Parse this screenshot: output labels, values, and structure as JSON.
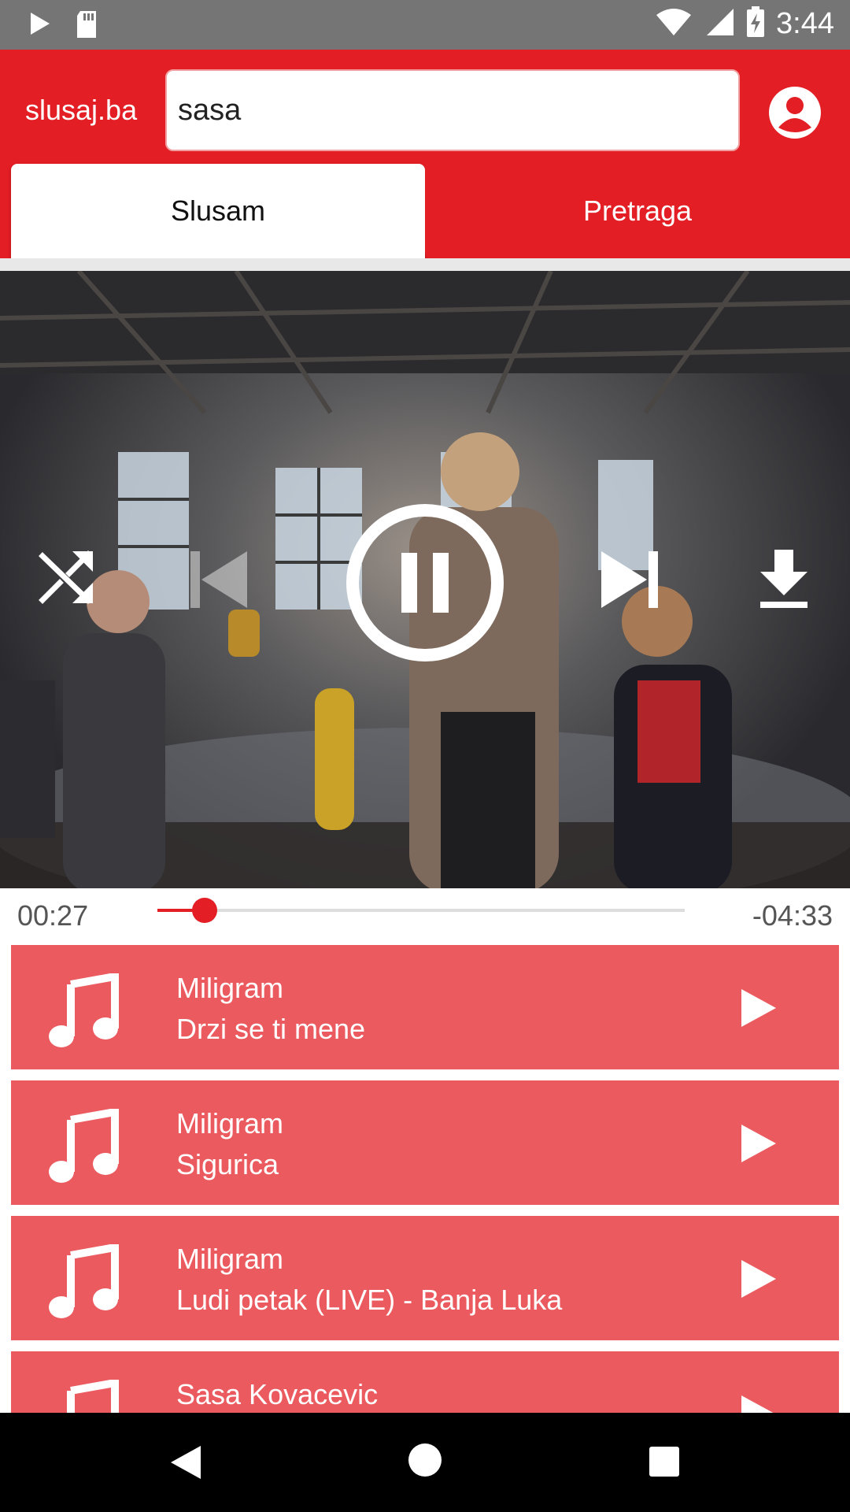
{
  "status_bar": {
    "time": "3:44",
    "icons": [
      "play-notification-icon",
      "sd-card-icon",
      "wifi-icon",
      "signal-icon",
      "battery-charging-icon"
    ]
  },
  "header": {
    "brand": "slusaj.ba",
    "search_value": "sasa",
    "search_placeholder": "",
    "account_icon": "account-circle-icon"
  },
  "tabs": [
    {
      "label": "Slusam",
      "active": true
    },
    {
      "label": "Pretraga",
      "active": false
    }
  ],
  "player": {
    "controls": [
      "shuffle-icon",
      "skip-previous-icon",
      "pause-icon",
      "skip-next-icon",
      "download-icon"
    ],
    "elapsed": "00:27",
    "remaining": "-04:33",
    "progress": 0.09
  },
  "songs": [
    {
      "artist": "Miligram",
      "title": "Drzi se ti mene"
    },
    {
      "artist": "Miligram",
      "title": "Sigurica"
    },
    {
      "artist": "Miligram",
      "title": "Ludi petak (LIVE) - Banja Luka"
    },
    {
      "artist": "Sasa Kovacevic",
      "title": ""
    }
  ],
  "colors": {
    "accent": "#e31e24",
    "list_item": "#eb5a5e",
    "status_bar": "#757575"
  }
}
